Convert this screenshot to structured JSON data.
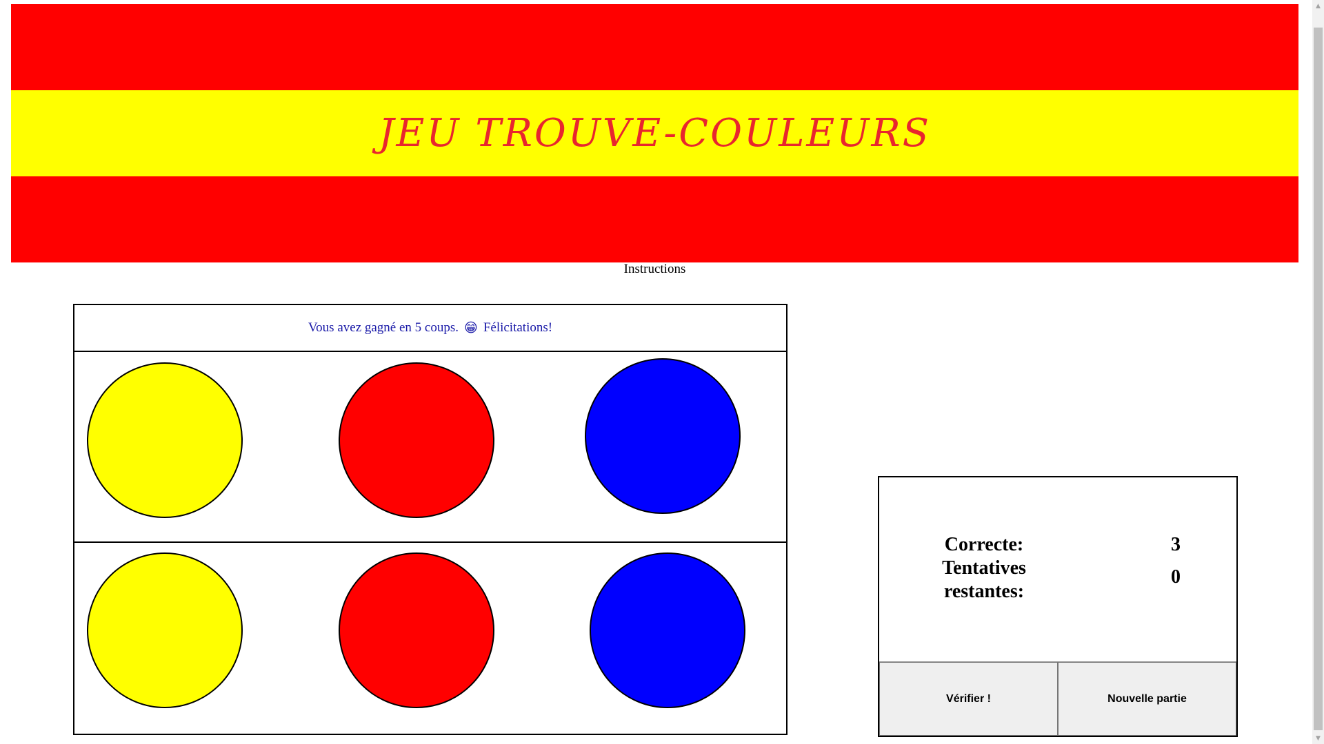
{
  "banner": {
    "title": "JEU TROUVE-COULEURS",
    "colors": {
      "red": "#ff0000",
      "yellow": "#ffff00",
      "title_color": "#e8262e"
    }
  },
  "instructions_label": "Instructions",
  "message": {
    "text_before": "Vous avez gagné en 5 coups.",
    "emoji": "😁",
    "text_after": "Félicitations!",
    "color": "#1a1aa8"
  },
  "guess_row": [
    {
      "color": "#ffff00",
      "name": "yellow"
    },
    {
      "color": "#ff0000",
      "name": "red"
    },
    {
      "color": "#0000ff",
      "name": "blue"
    }
  ],
  "secret_row": [
    {
      "color": "#ffff00",
      "name": "yellow"
    },
    {
      "color": "#ff0000",
      "name": "red"
    },
    {
      "color": "#0000ff",
      "name": "blue"
    }
  ],
  "score": {
    "correct_label": "Correcte:",
    "correct_value": "3",
    "attempts_label_1": "Tentatives",
    "attempts_label_2": "restantes:",
    "attempts_value": "0"
  },
  "buttons": {
    "verify": "Vérifier !",
    "new_game": "Nouvelle partie"
  },
  "scrollbar": {
    "up_icon": "▲",
    "down_icon": "▼"
  }
}
